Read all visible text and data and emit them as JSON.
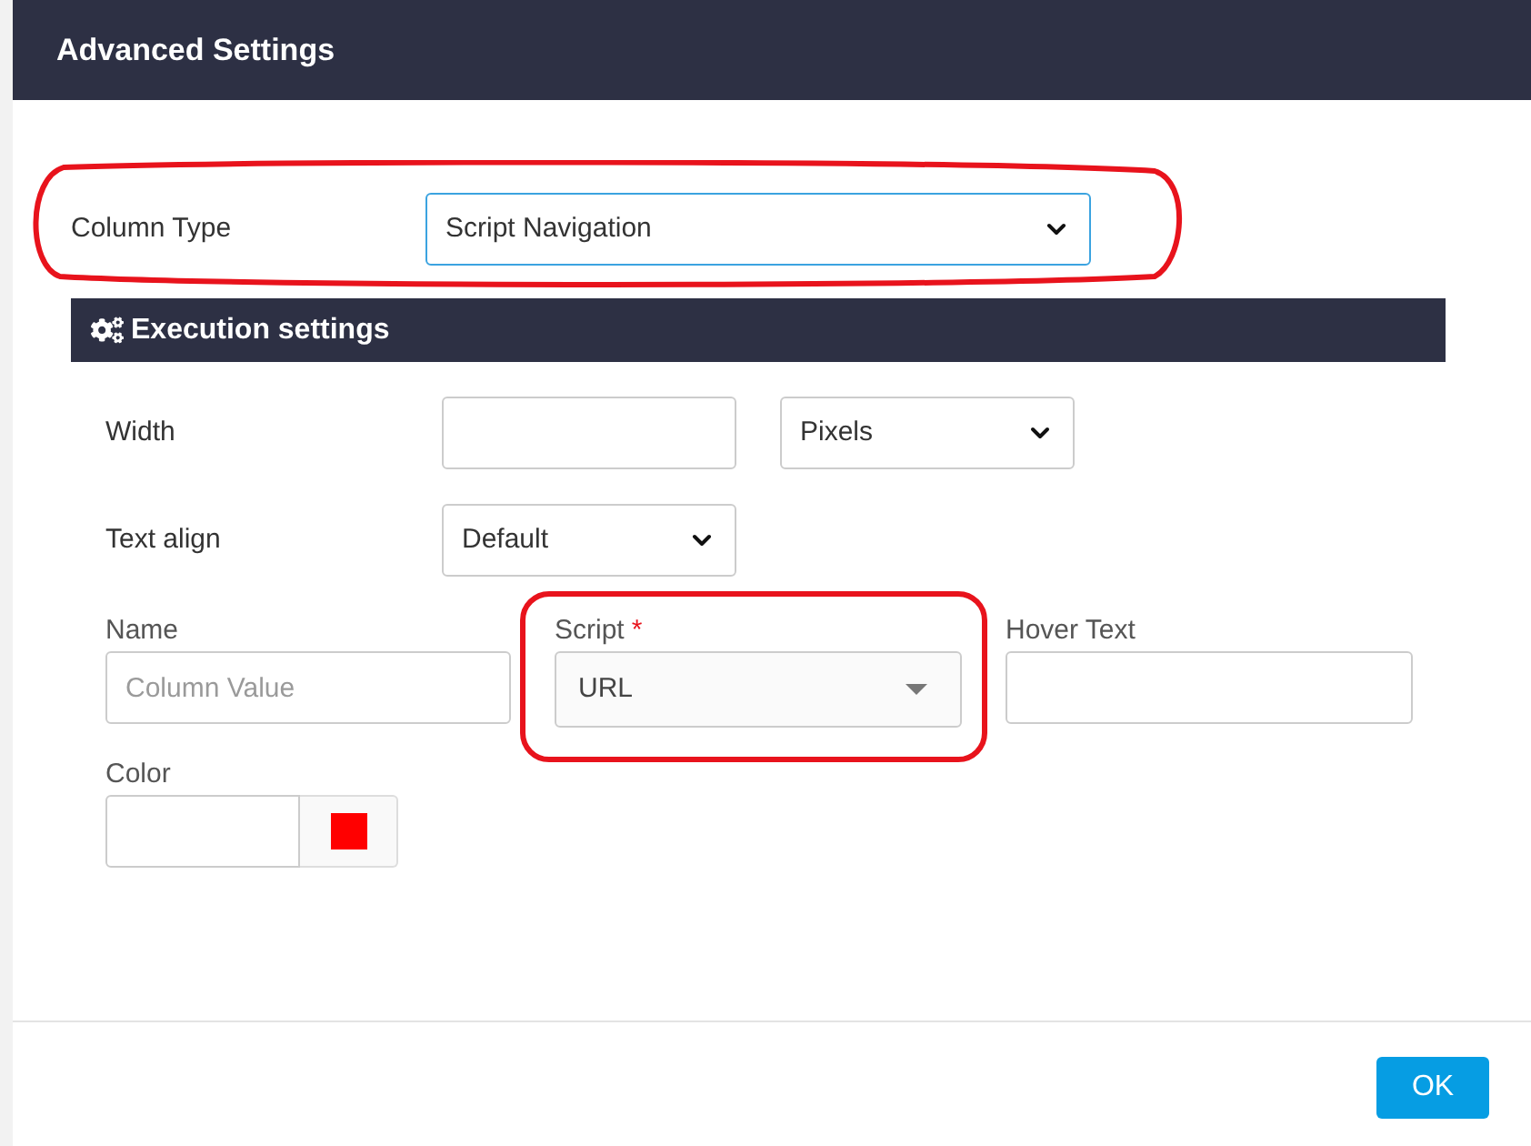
{
  "dialog": {
    "title": "Advanced Settings"
  },
  "column_type": {
    "label": "Column Type",
    "value": "Script Navigation",
    "focused": true,
    "highlighted": true
  },
  "section": {
    "title": "Execution settings"
  },
  "width": {
    "label": "Width",
    "unit": "Pixels"
  },
  "text_align": {
    "label": "Text align",
    "value": "Default"
  },
  "name": {
    "label": "Name",
    "placeholder": "Column Value"
  },
  "script": {
    "label": "Script",
    "required_mark": "*",
    "value": "URL",
    "highlighted": true
  },
  "hover_text": {
    "label": "Hover Text"
  },
  "color": {
    "label": "Color",
    "color": "#ff0000"
  },
  "ok_button": {
    "label": "OK"
  }
}
